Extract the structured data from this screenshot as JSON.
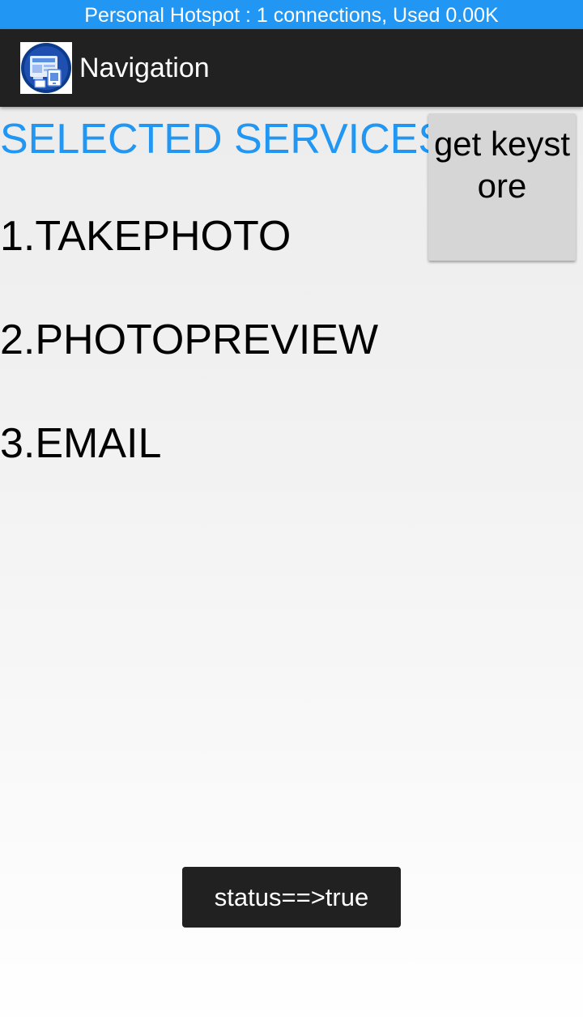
{
  "status_bar": {
    "text": "Personal Hotspot : 1 connections, Used 0.00K",
    "color": "#2196f3"
  },
  "app_bar": {
    "icon": "app-launcher-icon",
    "title": "Navigation",
    "background": "#212121"
  },
  "main": {
    "section_title": "SELECTED SERVICES",
    "accent_color": "#2196f3",
    "services": [
      "1.TAKEPHOTO",
      "2.PHOTOPREVIEW",
      "3.EMAIL"
    ],
    "keystore_button_label": "get keystore"
  },
  "toast": {
    "text": "status==>true"
  }
}
